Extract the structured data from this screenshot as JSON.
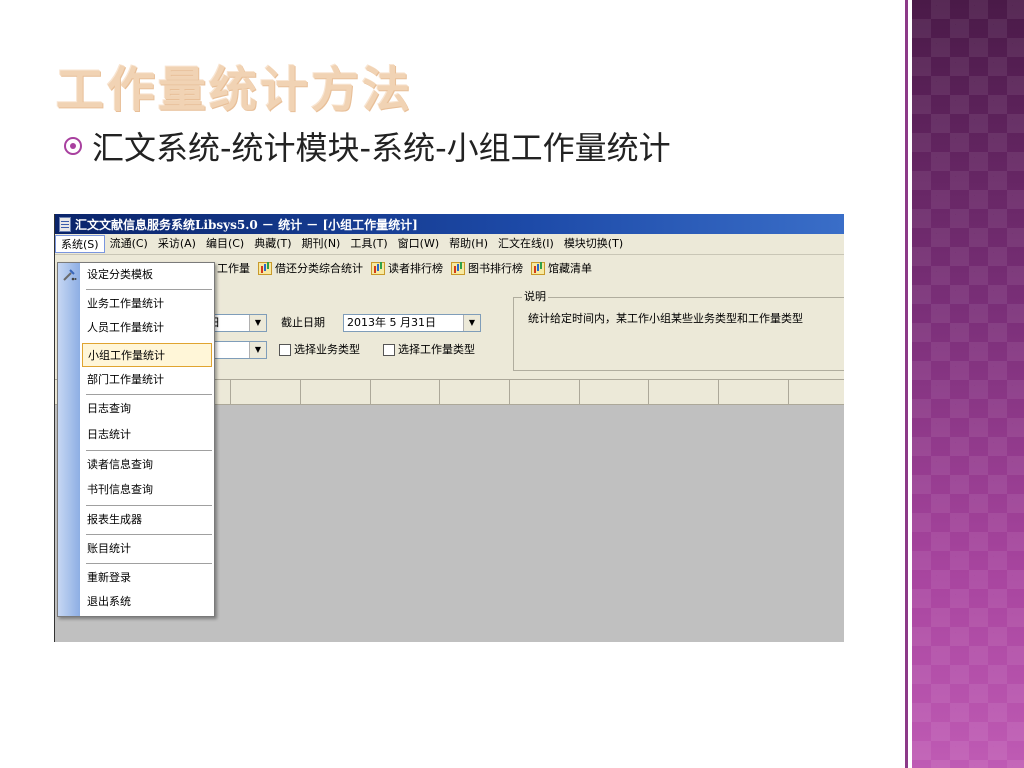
{
  "slide": {
    "title": "工作量统计方法",
    "bullet": "汇文系统-统计模块-系统-小组工作量统计"
  },
  "colors": {
    "title": "#f1d3b4",
    "accent": "#a8409f",
    "titlebar": "#0a246a",
    "side_band": "#7a2f78"
  },
  "app": {
    "window_title": "汇文文献信息服务系统Libsys5.0 － 统计 － [小组工作量统计]",
    "menu": [
      "系统(S)",
      "流通(C)",
      "采访(A)",
      "编目(C)",
      "典藏(T)",
      "期刊(N)",
      "工具(T)",
      "窗口(W)",
      "帮助(H)",
      "汇文在线(I)",
      "模块切换(T)"
    ],
    "toolbar": [
      "工作量",
      "借还分类综合统计",
      "读者排行榜",
      "图书排行榜",
      "馆藏清单"
    ],
    "params": {
      "combo1_value": "日",
      "end_date_label": "截止日期",
      "end_date_value": "2013年 5 月31日",
      "check_business": "选择业务类型",
      "check_workload": "选择工作量类型"
    },
    "description": {
      "title": "说明",
      "text": "统计给定时间内，某工作小组某些业务类型和工作量类型"
    },
    "dropdown": [
      "设定分类模板",
      "业务工作量统计",
      "人员工作量统计",
      "小组工作量统计",
      "部门工作量统计",
      "日志查询",
      "日志统计",
      "读者信息查询",
      "书刊信息查询",
      "报表生成器",
      "账目统计",
      "重新登录",
      "退出系统"
    ]
  }
}
